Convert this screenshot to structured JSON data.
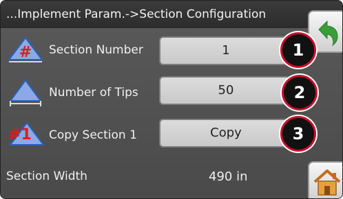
{
  "header": {
    "title": "...Implement Param.->Section Configuration"
  },
  "rows": [
    {
      "label": "Section Number",
      "value": "1",
      "icon": "section-number-icon"
    },
    {
      "label": "Number of Tips",
      "value": "50",
      "icon": "tips-icon"
    },
    {
      "label": "Copy Section 1",
      "value": "Copy",
      "icon": "copy-section-icon"
    }
  ],
  "callouts": [
    "1",
    "2",
    "3"
  ],
  "section_width": {
    "label": "Section Width",
    "value": "490 in"
  },
  "colors": {
    "accent_green": "#3a9d3a",
    "callout_red": "#c8102e",
    "icon_blue": "#2d5fb7",
    "house_orange": "#e7a13a"
  }
}
